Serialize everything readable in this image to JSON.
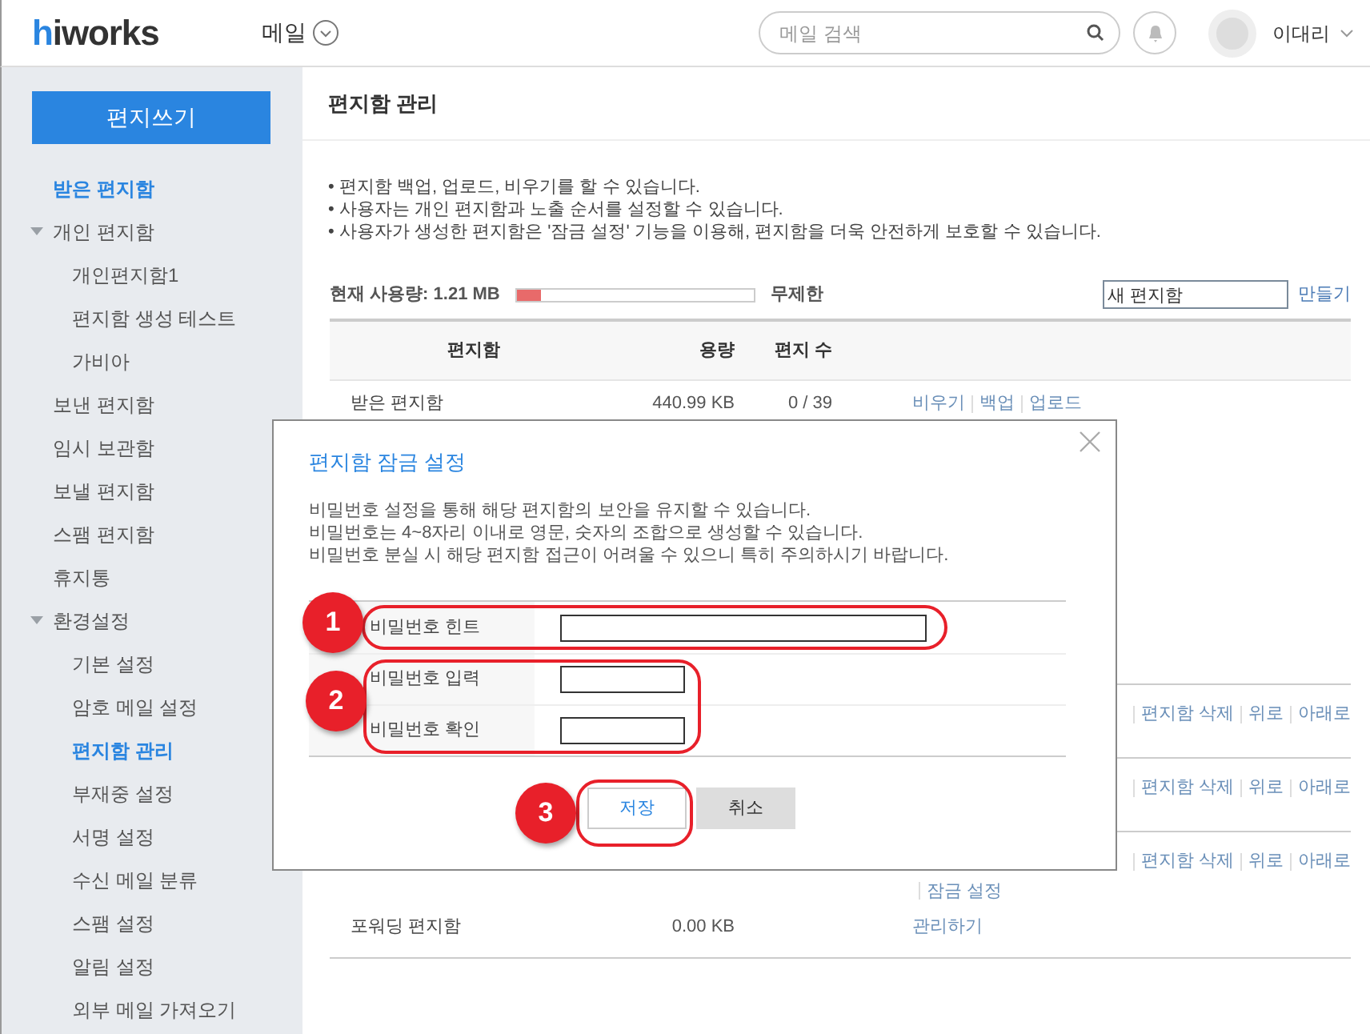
{
  "header": {
    "logo": "hiworks",
    "app_menu": "메일",
    "search": {
      "placeholder": "메일 검색"
    },
    "user": "이대리"
  },
  "sidebar": {
    "compose_button": "편지쓰기",
    "items": [
      {
        "label": "받은 편지함",
        "selected": true
      },
      {
        "label": "개인 편지함",
        "selected": false,
        "expanded": true,
        "children": [
          {
            "label": "개인편지함1",
            "selected": false
          },
          {
            "label": "편지함 생성 테스트",
            "selected": false
          },
          {
            "label": "가비아",
            "selected": false
          }
        ]
      },
      {
        "label": "보낸 편지함",
        "selected": false
      },
      {
        "label": "임시 보관함",
        "selected": false
      },
      {
        "label": "보낼 편지함",
        "selected": false
      },
      {
        "label": "스팸 편지함",
        "selected": false
      },
      {
        "label": "휴지통",
        "selected": false
      },
      {
        "label": "환경설정",
        "selected": false,
        "expanded": true,
        "children": [
          {
            "label": "기본 설정",
            "selected": false
          },
          {
            "label": "암호 메일 설정",
            "selected": false
          },
          {
            "label": "편지함 관리",
            "selected": true
          },
          {
            "label": "부재중 설정",
            "selected": false
          },
          {
            "label": "서명 설정",
            "selected": false
          },
          {
            "label": "수신 메일 분류",
            "selected": false
          },
          {
            "label": "스팸 설정",
            "selected": false
          },
          {
            "label": "알림 설정",
            "selected": false
          },
          {
            "label": "외부 메일 가져오기",
            "selected": false
          }
        ]
      }
    ]
  },
  "page_title": "편지함 관리",
  "notes": [
    "• 편지함 백업, 업로드, 비우기를 할 수 있습니다.",
    "• 사용자는 개인 편지함과 노출 순서를 설정할 수 있습니다.",
    "• 사용자가 생성한 편지함은 '잠금 설정' 기능을 이용해, 편지함을 더욱 안전하게 보호할 수 있습니다."
  ],
  "usage": {
    "label": "현재 사용량: 1.21 MB",
    "level": 0.1,
    "limit": "무제한"
  },
  "new_folder": {
    "value": "새 편지함",
    "button": "만들기"
  },
  "table": {
    "columns": [
      "편지함",
      "용량",
      "편지 수"
    ],
    "rows": [
      {
        "kind": "full",
        "name": "받은 편지함",
        "size": "440.99 KB",
        "count": "0 / 39",
        "actions": [
          [
            "비우기",
            "백업",
            "업로드"
          ]
        ]
      },
      {
        "kind": "covered"
      },
      {
        "kind": "covered"
      },
      {
        "kind": "covered"
      },
      {
        "kind": "links",
        "actions": [
          [
            "편지함 삭제",
            "위로",
            "아래로"
          ]
        ]
      },
      {
        "kind": "links",
        "actions": [
          [
            "편지함 삭제",
            "위로",
            "아래로"
          ]
        ]
      },
      {
        "kind": "links",
        "actions": [
          [
            "편지함 삭제",
            "위로",
            "아래로"
          ],
          [
            "잠금 설정"
          ]
        ]
      },
      {
        "kind": "full",
        "name": "포워딩 편지함",
        "size": "0.00 KB",
        "actions": [
          [
            "관리하기"
          ]
        ]
      }
    ]
  },
  "dialog": {
    "title": "편지함 잠금 설정",
    "description": [
      "비밀번호 설정을 통해 해당 편지함의 보안을 유지할 수 있습니다.",
      "비밀번호는 4~8자리 이내로 영문, 숫자의 조합으로 생성할 수 있습니다.",
      "비밀번호 분실 시 해당 편지함 접근이 어려울 수 있으니 특히 주의하시기 바랍니다."
    ],
    "fields": [
      {
        "label": "비밀번호 힌트",
        "kind": "wide"
      },
      {
        "label": "비밀번호 입력",
        "kind": "short"
      },
      {
        "label": "비밀번호 확인",
        "kind": "short"
      }
    ],
    "buttons": [
      {
        "label": "저장",
        "kind": "primary"
      },
      {
        "label": "취소",
        "kind": "secondary"
      }
    ]
  },
  "annotations": [
    {
      "label": "1"
    },
    {
      "label": "2"
    },
    {
      "label": "3"
    }
  ]
}
